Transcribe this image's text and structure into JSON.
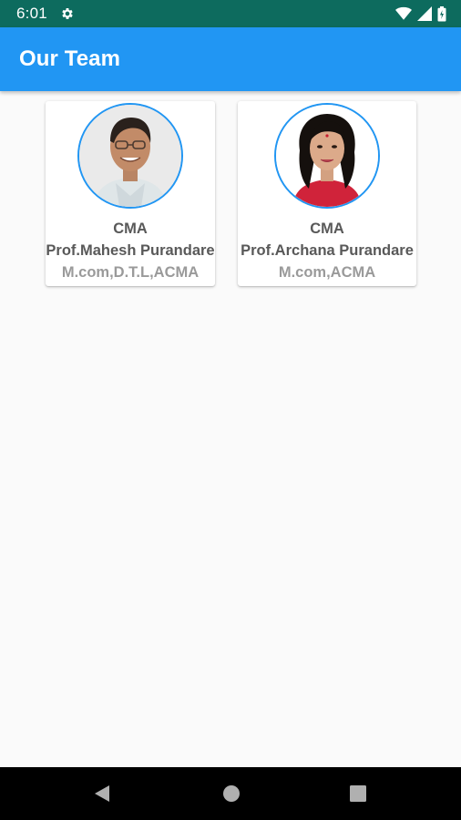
{
  "status_bar": {
    "time": "6:01",
    "icons": [
      "gear-icon",
      "wifi-icon",
      "signal-icon",
      "battery-icon"
    ]
  },
  "app_bar": {
    "title": "Our Team",
    "color": "#2196f3"
  },
  "team": [
    {
      "title": "CMA",
      "name": "Prof.Mahesh Purandare",
      "qualification": "M.com,D.T.L,ACMA"
    },
    {
      "title": "CMA",
      "name": "Prof.Archana Purandare",
      "qualification": "M.com,ACMA"
    }
  ],
  "nav_bar": {
    "icons": [
      "back-icon",
      "home-icon",
      "recents-icon"
    ]
  }
}
